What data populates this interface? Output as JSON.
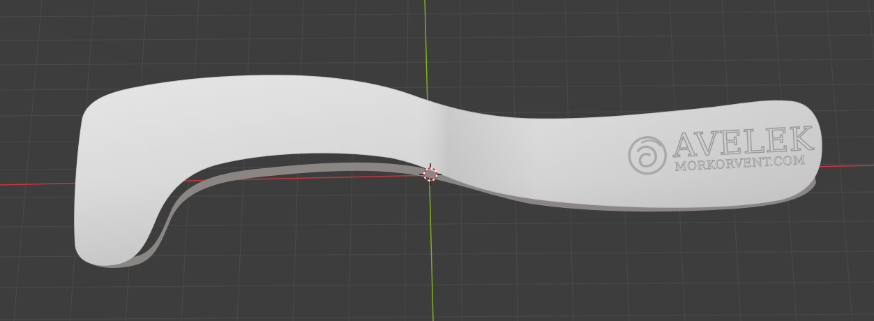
{
  "viewport": {
    "view": "3D Viewport",
    "background_color": "#3d3d3d",
    "grid_line_color": "#4a4a4a",
    "x_axis_color": "#c8363f",
    "y_axis_color": "#7fb022",
    "cursor_icon": "3d-cursor-icon"
  },
  "model": {
    "object": "sculpted-handle",
    "surface_color": "#d6d6d6",
    "shadow_color": "#8a8684",
    "embossed_logo_icon": "spiral-icon",
    "embossed_title": "AVELEK",
    "embossed_subtitle": "MORKORVENT.COM"
  }
}
